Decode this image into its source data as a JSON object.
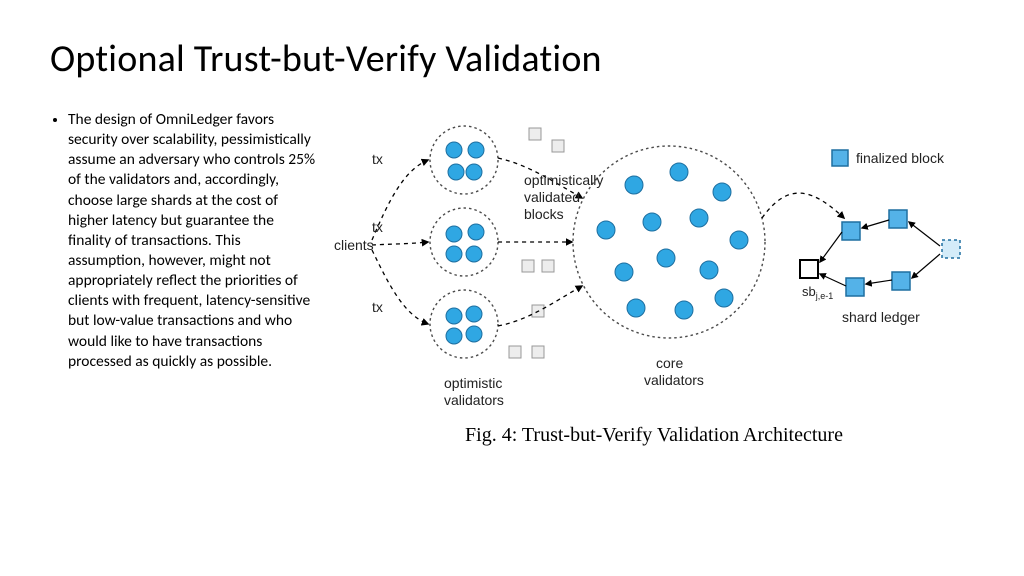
{
  "title": "Optional Trust-but-Verify Validation",
  "bullet": "The design of OmniLedger favors security over scalability, pessimistically assume an adversary who controls 25% of the validators and, accordingly, choose large shards at the cost of higher latency but guarantee the finality of transactions. This assumption, however, might not appropriately reflect the priorities of clients with frequent, latency-sensitive but low-value transactions and who would like to have transactions processed as quickly as possible.",
  "labels": {
    "tx1": "tx",
    "tx2": "tx",
    "tx3": "tx",
    "clients": "clients",
    "optimistic_validators": "optimistic\nvalidators",
    "optimistically_validated_blocks": "optimistically\nvalidated\nblocks",
    "core_validators": "core\nvalidators",
    "finalized_block": "finalized block",
    "sb": "sbj,e-1",
    "shard_ledger": "shard ledger"
  },
  "caption": "Fig. 4: Trust-but-Verify Validation Architecture",
  "colors": {
    "node_fill": "#2FA7E3",
    "node_stroke": "#1E6FA0",
    "block_fill": "#54B2E8",
    "block_stroke": "#1E6FA0",
    "grey_fill": "#EDEDED",
    "grey_stroke": "#989898",
    "dot": "#4B4B4B"
  }
}
